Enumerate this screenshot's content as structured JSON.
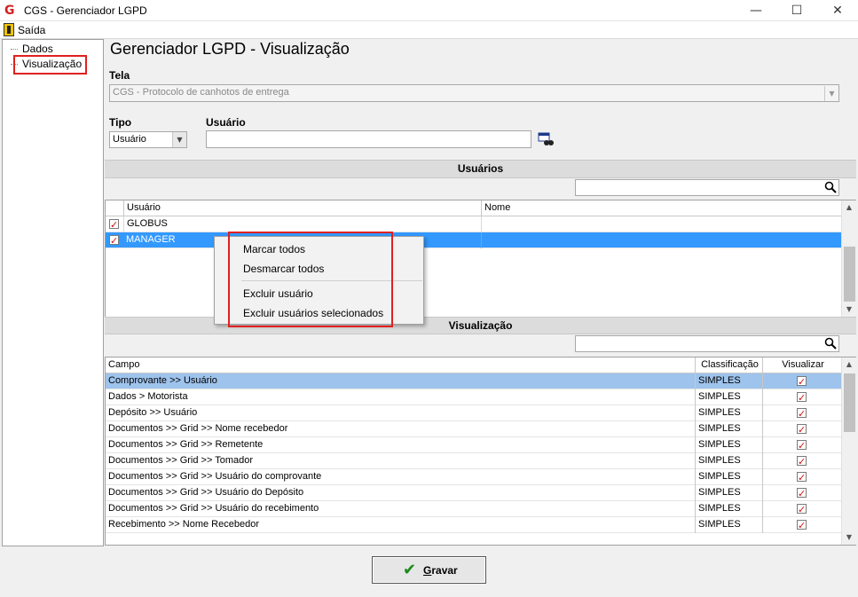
{
  "window": {
    "title": "CGS - Gerenciador LGPD",
    "logo": "G"
  },
  "menu": {
    "exit_label": "Saída"
  },
  "tree": {
    "items": [
      "Dados",
      "Visualização"
    ]
  },
  "page": {
    "title": "Gerenciador LGPD - Visualização"
  },
  "tela": {
    "label": "Tela",
    "value": "CGS - Protocolo de canhotos de entrega"
  },
  "tipo": {
    "label": "Tipo",
    "value": "Usuário"
  },
  "usuario_field": {
    "label": "Usuário",
    "value": ""
  },
  "users_section": {
    "title": "Usuários",
    "search_value": "",
    "columns": [
      "Usuário",
      "Nome"
    ],
    "rows": [
      {
        "checked": true,
        "usuario": "GLOBUS",
        "nome": ""
      },
      {
        "checked": true,
        "usuario": "MANAGER",
        "nome": ""
      }
    ]
  },
  "context_menu": {
    "items": [
      "Marcar todos",
      "Desmarcar todos",
      "Excluir usuário",
      "Excluir usuários selecionados"
    ]
  },
  "view_section": {
    "title": "Visualização",
    "search_value": "",
    "columns": [
      "Campo",
      "Classificação",
      "Visualizar"
    ],
    "rows": [
      {
        "campo": "Comprovante >> Usuário",
        "classificacao": "SIMPLES",
        "visualizar": true
      },
      {
        "campo": "Dados > Motorista",
        "classificacao": "SIMPLES",
        "visualizar": true
      },
      {
        "campo": "Depósito >> Usuário",
        "classificacao": "SIMPLES",
        "visualizar": true
      },
      {
        "campo": "Documentos >> Grid >> Nome recebedor",
        "classificacao": "SIMPLES",
        "visualizar": true
      },
      {
        "campo": "Documentos >> Grid >> Remetente",
        "classificacao": "SIMPLES",
        "visualizar": true
      },
      {
        "campo": "Documentos >> Grid >> Tomador",
        "classificacao": "SIMPLES",
        "visualizar": true
      },
      {
        "campo": "Documentos >> Grid >> Usuário do comprovante",
        "classificacao": "SIMPLES",
        "visualizar": true
      },
      {
        "campo": "Documentos >> Grid >> Usuário do Depósito",
        "classificacao": "SIMPLES",
        "visualizar": true
      },
      {
        "campo": "Documentos >> Grid >> Usuário do recebimento",
        "classificacao": "SIMPLES",
        "visualizar": true
      },
      {
        "campo": "Recebimento >> Nome Recebedor",
        "classificacao": "SIMPLES",
        "visualizar": true
      }
    ]
  },
  "save_button": {
    "label": "Gravar"
  },
  "colors": {
    "selection": "#3399ff",
    "row_highlight": "#9ec3ec",
    "annotation": "#e02020"
  }
}
